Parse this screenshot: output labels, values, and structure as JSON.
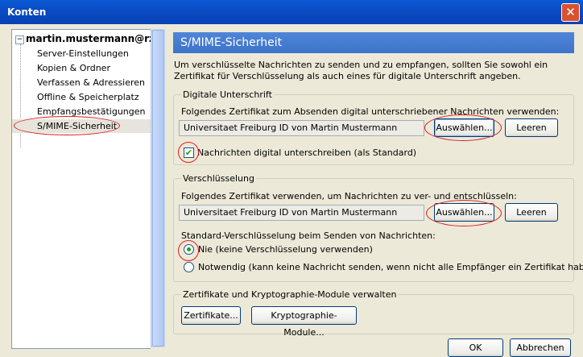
{
  "window": {
    "title": "Konten",
    "close_glyph": "✕"
  },
  "sidebar": {
    "account": "martin.mustermann@rz",
    "expand_glyph": "−",
    "items": [
      {
        "label": "Server-Einstellungen"
      },
      {
        "label": "Kopien & Ordner"
      },
      {
        "label": "Verfassen & Adressieren"
      },
      {
        "label": "Offline & Speicherplatz"
      },
      {
        "label": "Empfangsbestätigungen"
      },
      {
        "label": "S/MIME-Sicherheit",
        "selected": true
      }
    ]
  },
  "page": {
    "title": "S/MIME-Sicherheit",
    "intro": "Um verschlüsselte Nachrichten zu senden und zu empfangen, sollten Sie sowohl ein Zertifikat für Verschlüsselung als auch eines für digitale Unterschrift angeben.",
    "signing": {
      "legend": "Digitale Unterschrift",
      "description": "Folgendes Zertifikat zum Absenden digital unterschriebener Nachrichten verwenden:",
      "certificate": "Universitaet Freiburg ID von Martin Mustermann",
      "select_label": "Auswählen...",
      "clear_label": "Leeren",
      "checkbox_label": "Nachrichten digital unterschreiben (als Standard)",
      "checkbox_checked": true,
      "check_glyph": "✔"
    },
    "encryption": {
      "legend": "Verschlüsselung",
      "description": "Folgendes Zertifikat verwenden, um Nachrichten zu ver- und entschlüsseln:",
      "certificate": "Universitaet Freiburg ID von Martin Mustermann",
      "select_label": "Auswählen...",
      "clear_label": "Leeren",
      "default_label": "Standard-Verschlüsselung beim Senden von Nachrichten:",
      "option_never": "Nie (keine Verschlüsselung verwenden)",
      "option_required": "Notwendig (kann keine Nachricht senden, wenn nicht alle Empfänger ein Zertifikat haben)",
      "selected_option": "never"
    },
    "modules": {
      "legend": "Zertifikate und Kryptographie-Module verwalten",
      "certificates_label": "Zertifikate...",
      "crypto_label": "Kryptographie-Module..."
    }
  },
  "footer": {
    "ok_label": "OK",
    "cancel_label": "Abbrechen"
  },
  "colors": {
    "title_bar": "#0a4bc4",
    "header_bar": "#4f86d8",
    "highlight": "#e02020",
    "window_bg": "#ece9d8"
  }
}
